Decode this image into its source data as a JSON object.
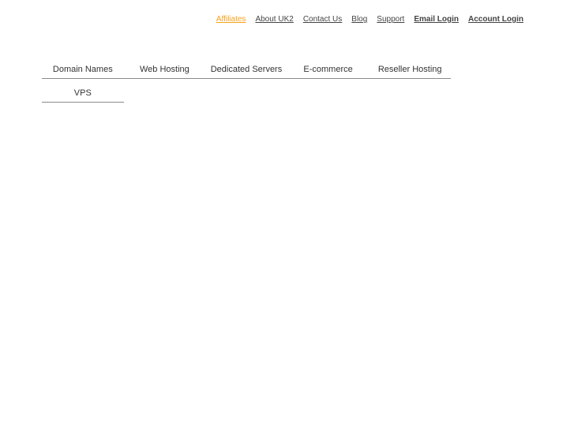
{
  "top_links": [
    {
      "label": "Affiliates"
    },
    {
      "label": "About UK2"
    },
    {
      "label": "Contact Us"
    },
    {
      "label": "Blog"
    },
    {
      "label": "Support"
    },
    {
      "label": "Email Login"
    },
    {
      "label": "Account Login"
    }
  ],
  "nav": {
    "items": [
      {
        "label": "Domain Names"
      },
      {
        "label": "Web Hosting"
      },
      {
        "label": "Dedicated Servers"
      },
      {
        "label": "E-commerce"
      },
      {
        "label": "Reseller Hosting"
      },
      {
        "label": "VPS"
      }
    ]
  },
  "colors": {
    "active_link": "#f7a11a",
    "link": "#444444",
    "nav_text": "#333333",
    "divider": "#8a8a8a"
  }
}
